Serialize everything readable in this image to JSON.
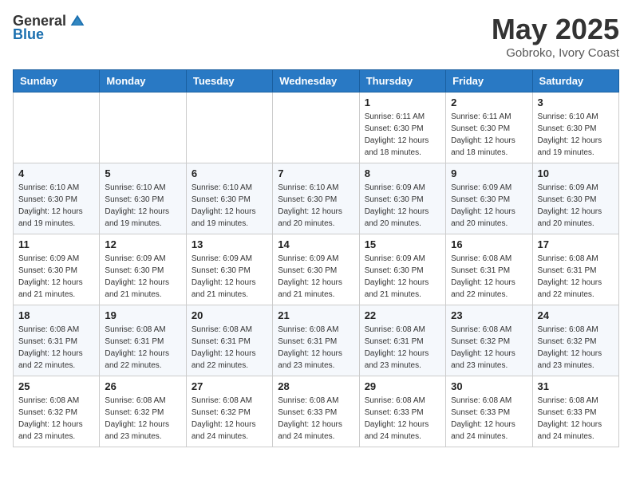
{
  "header": {
    "logo_general": "General",
    "logo_blue": "Blue",
    "month_title": "May 2025",
    "location": "Gobroko, Ivory Coast"
  },
  "weekdays": [
    "Sunday",
    "Monday",
    "Tuesday",
    "Wednesday",
    "Thursday",
    "Friday",
    "Saturday"
  ],
  "weeks": [
    [
      {
        "day": "",
        "info": ""
      },
      {
        "day": "",
        "info": ""
      },
      {
        "day": "",
        "info": ""
      },
      {
        "day": "",
        "info": ""
      },
      {
        "day": "1",
        "info": "Sunrise: 6:11 AM\nSunset: 6:30 PM\nDaylight: 12 hours\nand 18 minutes."
      },
      {
        "day": "2",
        "info": "Sunrise: 6:11 AM\nSunset: 6:30 PM\nDaylight: 12 hours\nand 18 minutes."
      },
      {
        "day": "3",
        "info": "Sunrise: 6:10 AM\nSunset: 6:30 PM\nDaylight: 12 hours\nand 19 minutes."
      }
    ],
    [
      {
        "day": "4",
        "info": "Sunrise: 6:10 AM\nSunset: 6:30 PM\nDaylight: 12 hours\nand 19 minutes."
      },
      {
        "day": "5",
        "info": "Sunrise: 6:10 AM\nSunset: 6:30 PM\nDaylight: 12 hours\nand 19 minutes."
      },
      {
        "day": "6",
        "info": "Sunrise: 6:10 AM\nSunset: 6:30 PM\nDaylight: 12 hours\nand 19 minutes."
      },
      {
        "day": "7",
        "info": "Sunrise: 6:10 AM\nSunset: 6:30 PM\nDaylight: 12 hours\nand 20 minutes."
      },
      {
        "day": "8",
        "info": "Sunrise: 6:09 AM\nSunset: 6:30 PM\nDaylight: 12 hours\nand 20 minutes."
      },
      {
        "day": "9",
        "info": "Sunrise: 6:09 AM\nSunset: 6:30 PM\nDaylight: 12 hours\nand 20 minutes."
      },
      {
        "day": "10",
        "info": "Sunrise: 6:09 AM\nSunset: 6:30 PM\nDaylight: 12 hours\nand 20 minutes."
      }
    ],
    [
      {
        "day": "11",
        "info": "Sunrise: 6:09 AM\nSunset: 6:30 PM\nDaylight: 12 hours\nand 21 minutes."
      },
      {
        "day": "12",
        "info": "Sunrise: 6:09 AM\nSunset: 6:30 PM\nDaylight: 12 hours\nand 21 minutes."
      },
      {
        "day": "13",
        "info": "Sunrise: 6:09 AM\nSunset: 6:30 PM\nDaylight: 12 hours\nand 21 minutes."
      },
      {
        "day": "14",
        "info": "Sunrise: 6:09 AM\nSunset: 6:30 PM\nDaylight: 12 hours\nand 21 minutes."
      },
      {
        "day": "15",
        "info": "Sunrise: 6:09 AM\nSunset: 6:30 PM\nDaylight: 12 hours\nand 21 minutes."
      },
      {
        "day": "16",
        "info": "Sunrise: 6:08 AM\nSunset: 6:31 PM\nDaylight: 12 hours\nand 22 minutes."
      },
      {
        "day": "17",
        "info": "Sunrise: 6:08 AM\nSunset: 6:31 PM\nDaylight: 12 hours\nand 22 minutes."
      }
    ],
    [
      {
        "day": "18",
        "info": "Sunrise: 6:08 AM\nSunset: 6:31 PM\nDaylight: 12 hours\nand 22 minutes."
      },
      {
        "day": "19",
        "info": "Sunrise: 6:08 AM\nSunset: 6:31 PM\nDaylight: 12 hours\nand 22 minutes."
      },
      {
        "day": "20",
        "info": "Sunrise: 6:08 AM\nSunset: 6:31 PM\nDaylight: 12 hours\nand 22 minutes."
      },
      {
        "day": "21",
        "info": "Sunrise: 6:08 AM\nSunset: 6:31 PM\nDaylight: 12 hours\nand 23 minutes."
      },
      {
        "day": "22",
        "info": "Sunrise: 6:08 AM\nSunset: 6:31 PM\nDaylight: 12 hours\nand 23 minutes."
      },
      {
        "day": "23",
        "info": "Sunrise: 6:08 AM\nSunset: 6:32 PM\nDaylight: 12 hours\nand 23 minutes."
      },
      {
        "day": "24",
        "info": "Sunrise: 6:08 AM\nSunset: 6:32 PM\nDaylight: 12 hours\nand 23 minutes."
      }
    ],
    [
      {
        "day": "25",
        "info": "Sunrise: 6:08 AM\nSunset: 6:32 PM\nDaylight: 12 hours\nand 23 minutes."
      },
      {
        "day": "26",
        "info": "Sunrise: 6:08 AM\nSunset: 6:32 PM\nDaylight: 12 hours\nand 23 minutes."
      },
      {
        "day": "27",
        "info": "Sunrise: 6:08 AM\nSunset: 6:32 PM\nDaylight: 12 hours\nand 24 minutes."
      },
      {
        "day": "28",
        "info": "Sunrise: 6:08 AM\nSunset: 6:33 PM\nDaylight: 12 hours\nand 24 minutes."
      },
      {
        "day": "29",
        "info": "Sunrise: 6:08 AM\nSunset: 6:33 PM\nDaylight: 12 hours\nand 24 minutes."
      },
      {
        "day": "30",
        "info": "Sunrise: 6:08 AM\nSunset: 6:33 PM\nDaylight: 12 hours\nand 24 minutes."
      },
      {
        "day": "31",
        "info": "Sunrise: 6:08 AM\nSunset: 6:33 PM\nDaylight: 12 hours\nand 24 minutes."
      }
    ]
  ]
}
